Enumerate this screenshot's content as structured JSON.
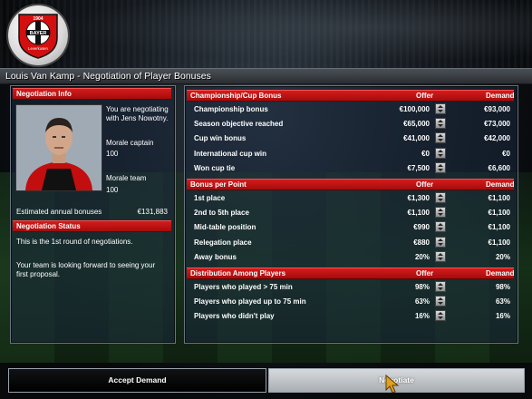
{
  "window_title": "Louis Van Kamp - Negotiation of Player Bonuses",
  "logo": {
    "top_text": "1904",
    "name": "BAYER",
    "sub_text": "Leverkusen",
    "icon": "club-crest-icon"
  },
  "negotiation_info": {
    "header": "Negotiation Info",
    "intro": [
      "You are negotiating",
      "with Jens Nowotny."
    ],
    "morale_captain_label": "Morale captain",
    "morale_captain_value": "100",
    "morale_team_label": "Morale team",
    "morale_team_value": "100",
    "estimated_label": "Estimated annual bonuses",
    "estimated_value": "€131,883"
  },
  "negotiation_status": {
    "header": "Negotiation Status",
    "line1": "This is the 1st round of negotiations.",
    "line2": [
      "Your team is looking forward to seeing your",
      "first proposal."
    ]
  },
  "sections": {
    "championship": {
      "header": "Championship/Cup Bonus",
      "offer_header": "Offer",
      "demand_header": "Demand",
      "rows": [
        {
          "label": "Championship bonus",
          "offer": "€100,000",
          "demand": "€93,000"
        },
        {
          "label": "Season objective reached",
          "offer": "€65,000",
          "demand": "€73,000"
        },
        {
          "label": "Cup win bonus",
          "offer": "€41,000",
          "demand": "€42,000"
        },
        {
          "label": "International cup win",
          "offer": "€0",
          "demand": "€0"
        },
        {
          "label": "Won cup tie",
          "offer": "€7,500",
          "demand": "€6,600"
        }
      ]
    },
    "per_point": {
      "header": "Bonus per Point",
      "offer_header": "Offer",
      "demand_header": "Demand",
      "rows": [
        {
          "label": "1st place",
          "offer": "€1,300",
          "demand": "€1,100"
        },
        {
          "label": "2nd to 5th place",
          "offer": "€1,100",
          "demand": "€1,100"
        },
        {
          "label": "Mid-table position",
          "offer": "€990",
          "demand": "€1,100"
        },
        {
          "label": "Relegation place",
          "offer": "€880",
          "demand": "€1,100"
        },
        {
          "label": "Away bonus",
          "offer": "20%",
          "demand": "20%"
        }
      ]
    },
    "distribution": {
      "header": "Distribution Among Players",
      "offer_header": "Offer",
      "demand_header": "Demand",
      "rows": [
        {
          "label": "Players who played > 75 min",
          "offer": "98%",
          "demand": "98%"
        },
        {
          "label": "Players who played up to 75 min",
          "offer": "63%",
          "demand": "63%"
        },
        {
          "label": "Players who didn't play",
          "offer": "16%",
          "demand": "16%"
        }
      ]
    }
  },
  "buttons": {
    "accept": "Accept Demand",
    "negotiate": "Negotiate"
  },
  "colors": {
    "header_red": "#c21414",
    "panel_border": "#6b7480"
  }
}
